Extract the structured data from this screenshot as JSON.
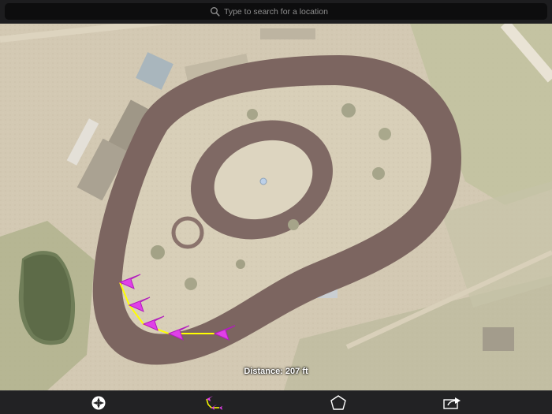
{
  "search": {
    "placeholder": "Type to search for a location"
  },
  "map": {
    "measurement_label": "Distance: 207 ft",
    "measure_line_color": "#ffff00",
    "marker_color": "#e040e8"
  },
  "toolbar": {
    "items": [
      {
        "name": "compass-icon"
      },
      {
        "name": "measure-distance-icon"
      },
      {
        "name": "polygon-icon"
      },
      {
        "name": "share-icon"
      }
    ]
  }
}
